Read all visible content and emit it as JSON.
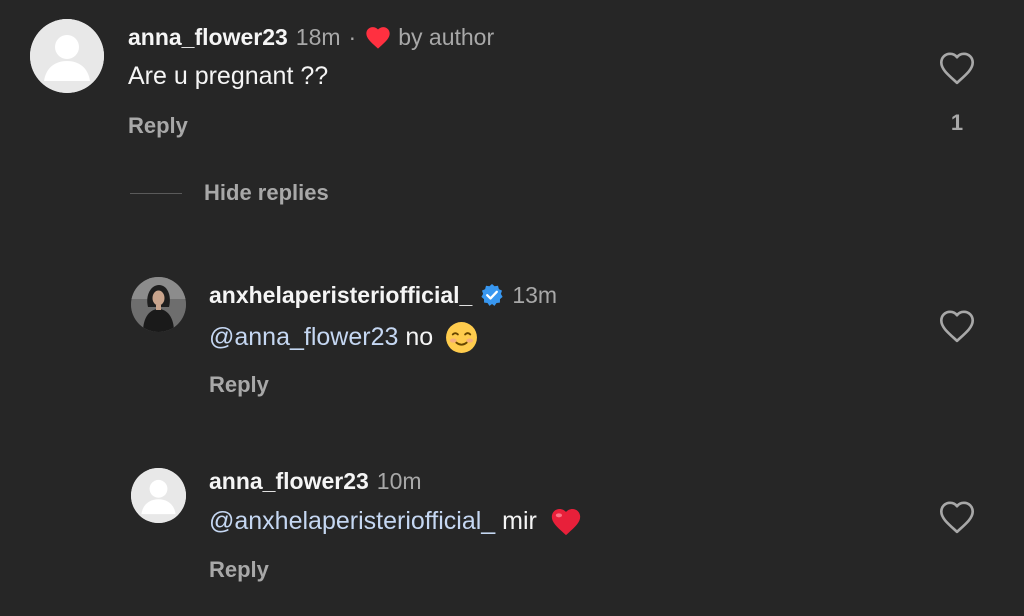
{
  "comment": {
    "username": "anna_flower23",
    "time": "18m",
    "separator": "·",
    "liked_by_author_label": "by author",
    "text": "Are u pregnant ??",
    "reply_label": "Reply",
    "like_count": "1",
    "avatar_icon": "default-avatar-icon",
    "like_icon": "heart-outline-icon"
  },
  "replies_toggle": {
    "label": "Hide replies"
  },
  "replies": [
    {
      "username": "anxhelaperisteriofficial_",
      "verified": true,
      "time": "13m",
      "mention": "@anna_flower23",
      "text": " no",
      "emoji": "☺️",
      "reply_label": "Reply",
      "avatar_icon": "profile-photo-icon"
    },
    {
      "username": "anna_flower23",
      "time": "10m",
      "mention": "@anxhelaperisteriofficial_",
      "text": " mir",
      "emoji": "❤️",
      "reply_label": "Reply",
      "avatar_icon": "default-avatar-icon"
    }
  ],
  "colors": {
    "background": "#262626",
    "text_primary": "#f5f5f5",
    "text_muted": "#a8a8a8",
    "mention": "#c5d7f2",
    "author_heart": "#ff3040",
    "verified": "#3897f0"
  }
}
